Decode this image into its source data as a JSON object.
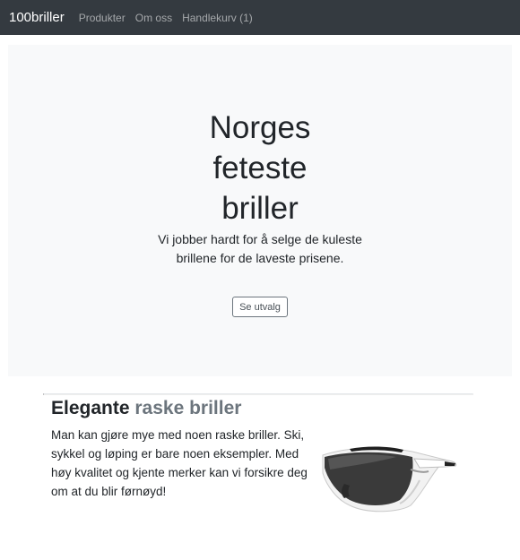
{
  "navbar": {
    "brand": "100briller",
    "links": [
      "Produkter",
      "Om oss",
      "Handlekurv (1)"
    ]
  },
  "hero": {
    "title": "Norges feteste briller",
    "lead": "Vi jobber hardt for å selge de kuleste brillene for de laveste prisene.",
    "button_label": "Se utvalg"
  },
  "feature": {
    "heading_main": "Elegante",
    "heading_muted": "raske briller",
    "body": "Man kan gjøre mye med noen raske briller. Ski, sykkel og løping er bare noen eksempler. Med høy kvalitet og kjente merker kan vi forsikre deg om at du blir førnøyd!"
  },
  "colors": {
    "navbar_bg": "#343a40",
    "hero_bg": "#f8f9fa",
    "muted_text": "#6c757d"
  }
}
